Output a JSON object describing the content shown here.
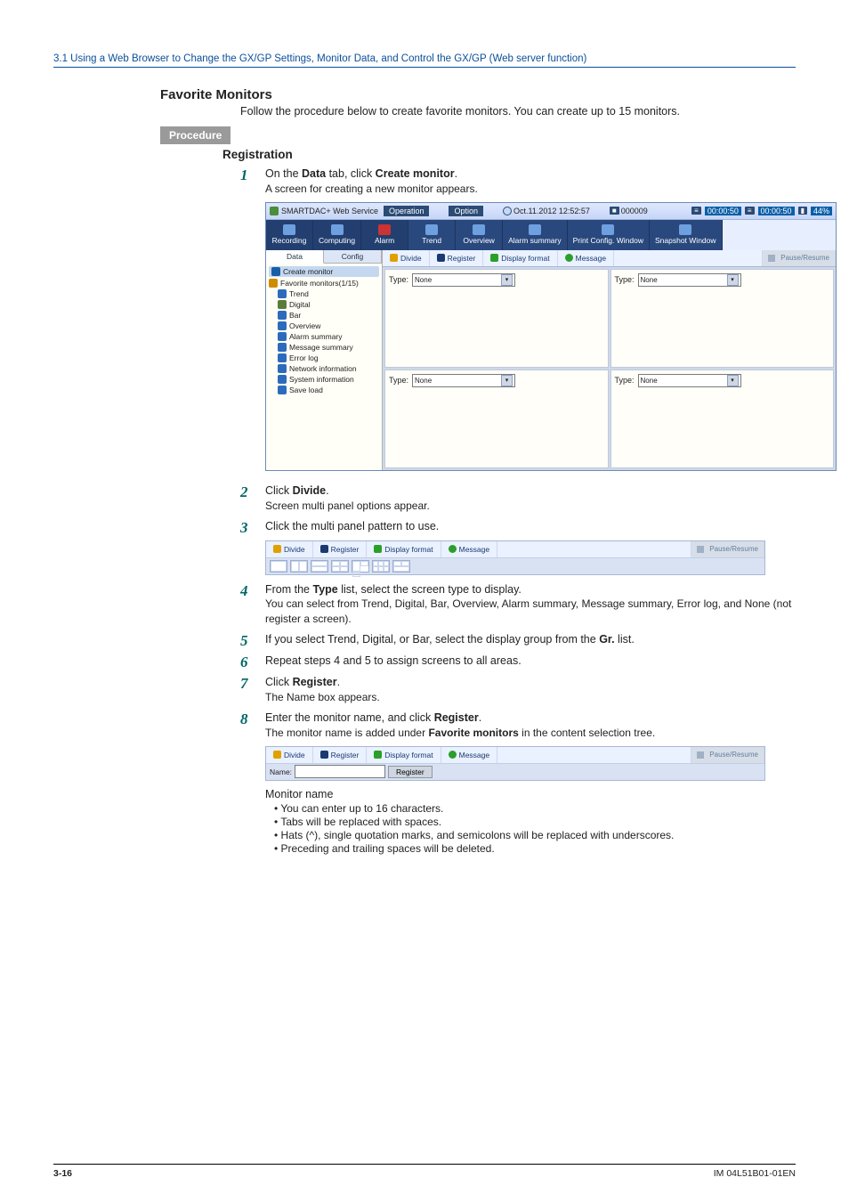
{
  "header": "3.1  Using a Web Browser to Change the GX/GP Settings, Monitor Data, and Control the GX/GP (Web server function)",
  "section_title": "Favorite Monitors",
  "section_intro": "Follow the procedure below to create favorite monitors. You can create up to 15 monitors.",
  "procedure_label": "Procedure",
  "subhead": "Registration",
  "steps": {
    "s1": {
      "text_a": "On the ",
      "bold_a": "Data",
      "text_b": " tab, click ",
      "bold_b": "Create monitor",
      "text_c": ".",
      "note": "A screen for creating a new monitor appears."
    },
    "s2": {
      "text_a": "Click ",
      "bold_a": "Divide",
      "text_b": ".",
      "note": "Screen multi panel options appear."
    },
    "s3": {
      "text": "Click the multi panel pattern to use."
    },
    "s4": {
      "text_a": "From the ",
      "bold_a": "Type",
      "text_b": " list, select the screen type to display.",
      "note": "You can select from Trend, Digital, Bar, Overview, Alarm summary, Message summary, Error log, and None (not register a screen)."
    },
    "s5": {
      "text_a": "If you select Trend, Digital, or Bar, select the display group from the ",
      "bold_a": "Gr.",
      "text_b": " list."
    },
    "s6": {
      "text": "Repeat steps 4 and 5 to assign screens to all areas."
    },
    "s7": {
      "text_a": "Click ",
      "bold_a": "Register",
      "text_b": ".",
      "note": "The Name box appears."
    },
    "s8": {
      "text_a": "Enter the monitor name, and click ",
      "bold_a": "Register",
      "text_b": ".",
      "note_a": "The monitor name is added under ",
      "note_bold": "Favorite monitors",
      "note_b": " in the content selection tree."
    }
  },
  "app": {
    "title": "SMARTDAC+ Web Service",
    "menubar": {
      "operation": "Operation",
      "option": "Option"
    },
    "datetime": "Oct.11.2012 12:52:57",
    "counter": "000009",
    "time1": "00:00:50",
    "time2": "00:00:50",
    "pct": "44%",
    "toolbar": [
      "Recording",
      "Computing",
      "Alarm",
      "Trend",
      "Overview",
      "Alarm summary",
      "Print Config. Window",
      "Snapshot Window"
    ],
    "side_tabs": {
      "data": "Data",
      "config": "Config"
    },
    "tree": {
      "create": "Create monitor",
      "fav": "Favorite monitors(1/15)",
      "items": [
        "Trend",
        "Digital",
        "Bar",
        "Overview",
        "Alarm summary",
        "Message summary",
        "Error log",
        "Network information",
        "System information",
        "Save load"
      ]
    },
    "tabs": {
      "divide": "Divide",
      "register": "Register",
      "display_format": "Display format",
      "message": "Message",
      "pause": "Pause/Resume"
    },
    "panel": {
      "type_label": "Type:",
      "type_val": "None"
    }
  },
  "mini8": {
    "name_label": "Name:",
    "register_btn": "Register"
  },
  "monitor_name": {
    "heading": "Monitor name",
    "bullets": [
      "You can enter up to 16 characters.",
      "Tabs will be replaced with spaces.",
      "Hats (^), single quotation marks, and semicolons will be replaced with underscores.",
      "Preceding and trailing spaces will be deleted."
    ]
  },
  "footer": {
    "page": "3-16",
    "doc": "IM 04L51B01-01EN"
  }
}
